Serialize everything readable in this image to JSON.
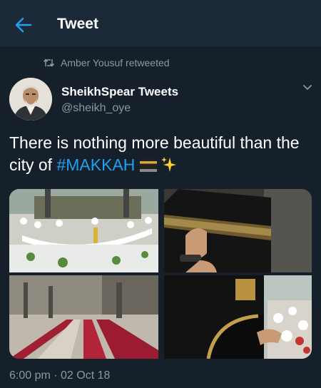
{
  "header": {
    "title": "Tweet",
    "back_icon": "back-arrow-icon",
    "accent": "#1da1f2"
  },
  "retweet": {
    "icon": "retweet-icon",
    "text": "Amber Yousuf retweeted"
  },
  "tweet": {
    "author_name": "SheikhSpear Tweets",
    "author_handle": "@sheikh_oye",
    "text_before": "There is nothing more beautiful than the city of ",
    "hashtag": "#MAKKAH",
    "emojis": [
      "kaaba-emoji",
      "sparkles-emoji"
    ],
    "timestamp": "6:00 pm · 02 Oct 18",
    "media": [
      {
        "name": "photo-kaaba-crowd"
      },
      {
        "name": "photo-kaaba-closeup"
      },
      {
        "name": "photo-mosque-interior"
      },
      {
        "name": "photo-kiswah-prayer"
      }
    ]
  },
  "colors": {
    "background": "#15202b",
    "header": "#1c2938",
    "secondary_text": "#8899a6",
    "link": "#1da1f2"
  }
}
